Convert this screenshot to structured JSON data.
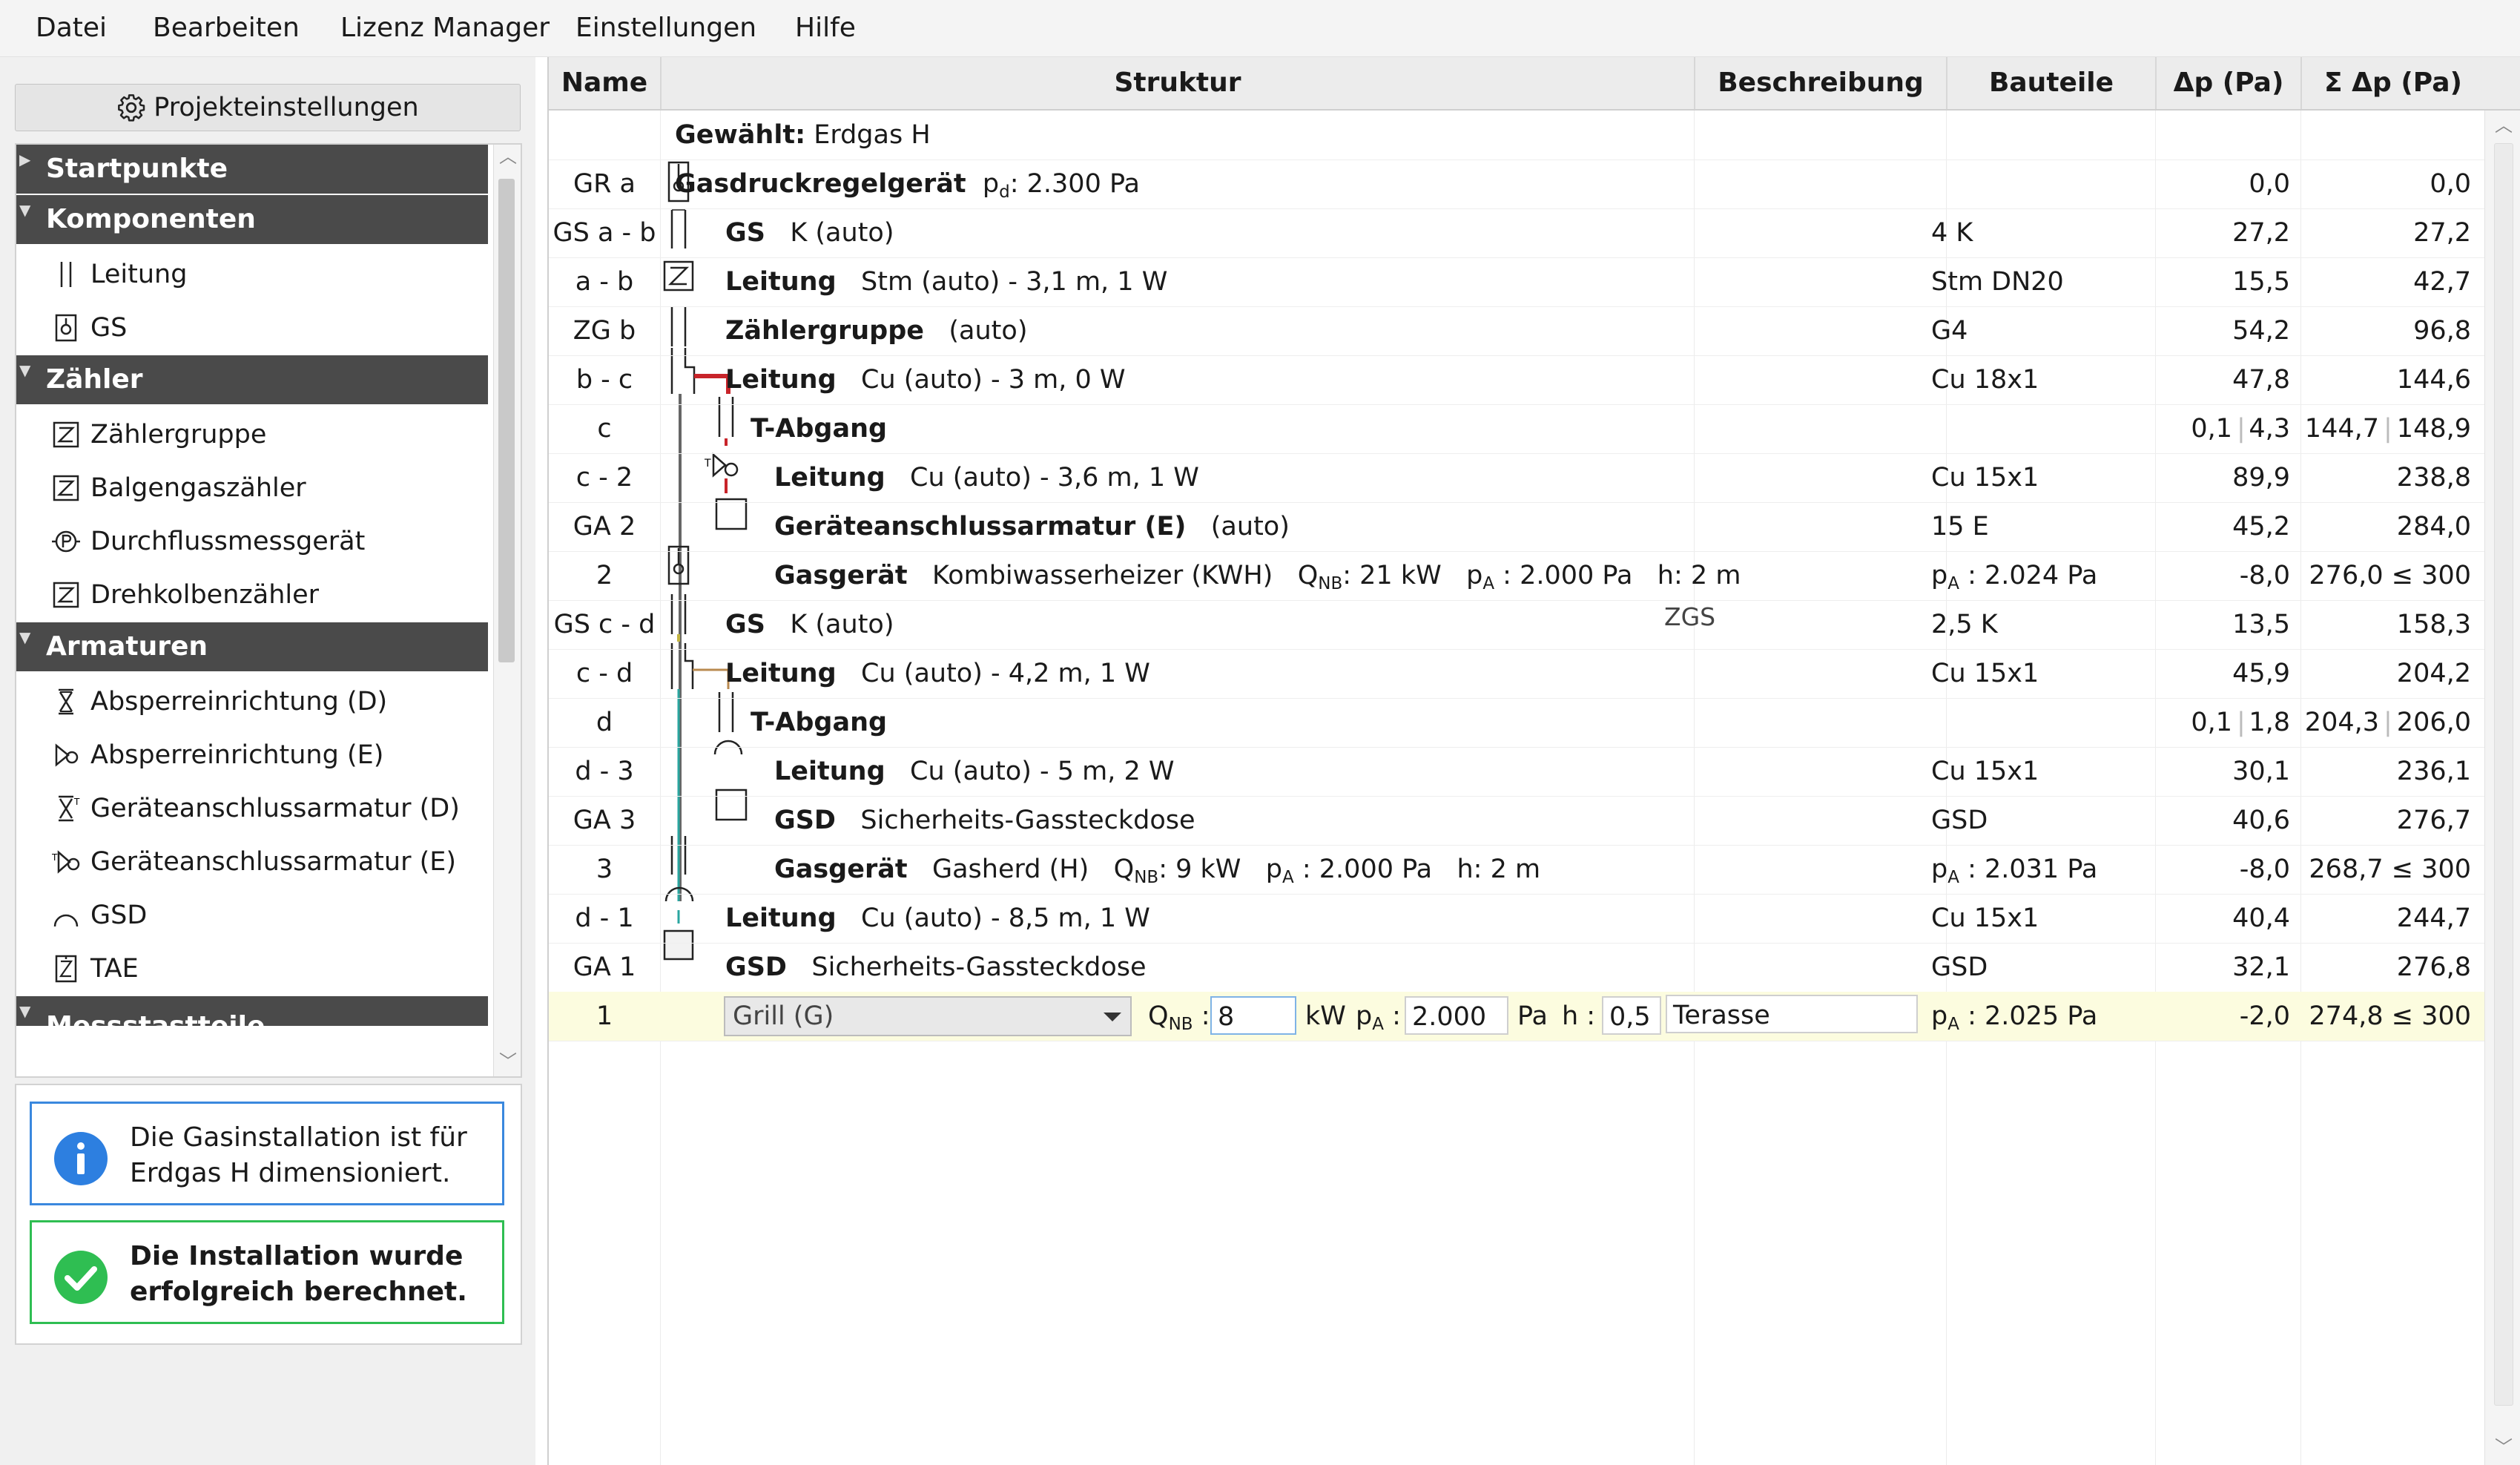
{
  "menu": [
    "Datei",
    "Bearbeiten",
    "Lizenz Manager",
    "Einstellungen",
    "Hilfe"
  ],
  "sidebar": {
    "project_button": "Projekteinstellungen",
    "categories": {
      "start": "Startpunkte",
      "komponenten": "Komponenten",
      "zaehler": "Zähler",
      "armaturen": "Armaturen",
      "next_cut": "Messstastteile"
    },
    "items": {
      "leitung": "Leitung",
      "gs": "GS",
      "zaehlergruppe": "Zählergruppe",
      "balgengaszaehler": "Balgengaszähler",
      "durchfluss": "Durchflussmessgerät",
      "drehkolben": "Drehkolbenzähler",
      "absperr_d": "Absperreinrichtung (D)",
      "absperr_e": "Absperreinrichtung (E)",
      "geraete_d": "Geräteanschlussarmatur (D)",
      "geraete_e": "Geräteanschlussarmatur (E)",
      "gsd": "GSD",
      "tae": "TAE"
    },
    "messages": {
      "info_l1": "Die Gasinstallation ist für",
      "info_l2": "Erdgas H dimensioniert.",
      "ok_l1": "Die Installation wurde",
      "ok_l2": "erfolgreich berechnet."
    }
  },
  "table": {
    "headers": {
      "name": "Name",
      "struktur": "Struktur",
      "beschreibung": "Beschreibung",
      "bauteile": "Bauteile",
      "dp": "Δp (Pa)",
      "sdp": "Σ Δp (Pa)"
    },
    "rows": [
      {
        "name": "",
        "s_bold": "Gewählt:",
        "s_text": "Erdgas H",
        "bauteile": "",
        "dp": "",
        "sdp": ""
      },
      {
        "name": "GR a",
        "s_bold": "Gasdruckregelgerät",
        "s_text": "2.300 Pa",
        "s_prefix": "p",
        "s_sub": "d",
        "bauteile": "",
        "dp": "0,0",
        "sdp": "0,0"
      },
      {
        "name": "GS a - b",
        "s_bold": "GS",
        "s_text": "K (auto)",
        "bauteile": "4 K",
        "dp": "27,2",
        "sdp": "27,2"
      },
      {
        "name": "a - b",
        "s_bold": "Leitung",
        "s_text": "Stm (auto) - 3,1 m, 1 W",
        "bauteile": "Stm DN20",
        "dp": "15,5",
        "sdp": "42,7"
      },
      {
        "name": "ZG b",
        "s_bold": "Zählergruppe",
        "s_text": "(auto)",
        "bauteile": "G4",
        "dp": "54,2",
        "sdp": "96,8"
      },
      {
        "name": "b - c",
        "s_bold": "Leitung",
        "s_text": "Cu (auto) - 3 m, 0 W",
        "bauteile": "Cu 18x1",
        "dp": "47,8",
        "sdp": "144,6"
      },
      {
        "name": "c",
        "s_bold": "T-Abgang",
        "s_text": "",
        "bauteile": "",
        "dp_a": "0,1",
        "dp_b": "4,3",
        "sdp_a": "144,7",
        "sdp_b": "148,9"
      },
      {
        "name": "c - 2",
        "s_bold": "Leitung",
        "s_text": "Cu (auto) - 3,6 m, 1 W",
        "bauteile": "Cu 15x1",
        "dp": "89,9",
        "sdp": "238,8"
      },
      {
        "name": "GA 2",
        "s_bold": "Geräteanschlussarmatur (E)",
        "s_text": "(auto)",
        "bauteile": "15 E",
        "dp": "45,2",
        "sdp": "284,0"
      },
      {
        "name": "2",
        "s_bold": "Gasgerät",
        "s_text": "Kombiwasserheizer (KWH)",
        "q": "21 kW",
        "p": "2.000 Pa",
        "h": "2 m",
        "bauteile": "2.024 Pa",
        "dp": "-8,0",
        "sdp": "276,0 ≤ 300"
      },
      {
        "name": "GS c - d",
        "s_bold": "GS",
        "s_text": "K (auto)",
        "beschr": "ZGS",
        "bauteile": "2,5 K",
        "dp": "13,5",
        "sdp": "158,3"
      },
      {
        "name": "c - d",
        "s_bold": "Leitung",
        "s_text": "Cu (auto) - 4,2 m, 1 W",
        "bauteile": "Cu 15x1",
        "dp": "45,9",
        "sdp": "204,2"
      },
      {
        "name": "d",
        "s_bold": "T-Abgang",
        "s_text": "",
        "bauteile": "",
        "dp_a": "0,1",
        "dp_b": "1,8",
        "sdp_a": "204,3",
        "sdp_b": "206,0"
      },
      {
        "name": "d - 3",
        "s_bold": "Leitung",
        "s_text": "Cu (auto) - 5 m, 2 W",
        "bauteile": "Cu 15x1",
        "dp": "30,1",
        "sdp": "236,1"
      },
      {
        "name": "GA 3",
        "s_bold": "GSD",
        "s_text": "Sicherheits-Gassteckdose",
        "bauteile": "GSD",
        "dp": "40,6",
        "sdp": "276,7"
      },
      {
        "name": "3",
        "s_bold": "Gasgerät",
        "s_text": "Gasherd (H)",
        "q": "9 kW",
        "p": "2.000 Pa",
        "h": "2 m",
        "bauteile": "2.031 Pa",
        "dp": "-8,0",
        "sdp": "268,7 ≤ 300"
      },
      {
        "name": "d - 1",
        "s_bold": "Leitung",
        "s_text": "Cu (auto) - 8,5 m, 1 W",
        "bauteile": "Cu 15x1",
        "dp": "40,4",
        "sdp": "244,7"
      },
      {
        "name": "GA 1",
        "s_bold": "GSD",
        "s_text": "Sicherheits-Gassteckdose",
        "bauteile": "GSD",
        "dp": "32,1",
        "sdp": "276,8"
      },
      {
        "name": "1",
        "select": "Grill (G)",
        "q_val": "8",
        "q_unit": "kW",
        "p_val": "2.000",
        "p_unit": "Pa",
        "h_val": "0,5",
        "beschr": "Terasse",
        "bauteile": "2.025 Pa",
        "dp": "-2,0",
        "sdp": "274,8 ≤ 300"
      }
    ],
    "labels": {
      "q": "Q",
      "q_sub": "NB",
      "p": "p",
      "p_sub": "A",
      "h": "h:",
      "h_edit": "h :",
      "colon": ":"
    }
  }
}
